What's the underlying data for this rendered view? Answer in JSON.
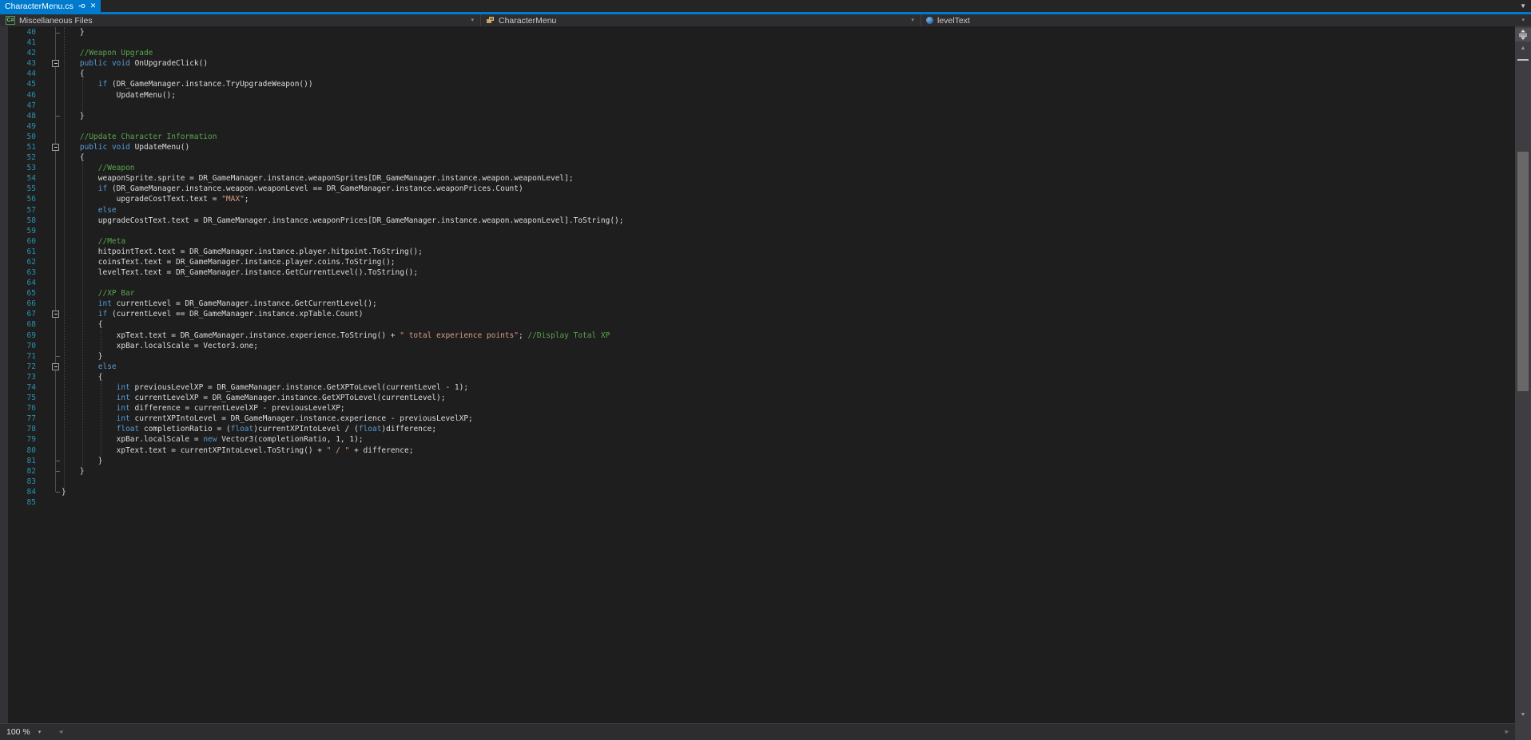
{
  "colors": {
    "accent_blue": "#007ACC",
    "editor_bg": "#1E1E1E",
    "shell_bg": "#2D2D30",
    "line_number": "#2B91AF",
    "keyword": "#569CD6",
    "comment": "#57A64A",
    "string": "#D69D85",
    "plain_text": "#DCDCDC",
    "scrollbar_track": "#3E3E42",
    "scrollbar_thumb": "#686868"
  },
  "icons": {
    "dropdown": "▾",
    "doc_dropdown": "▼",
    "close": "✕",
    "scroll_up": "▲",
    "scroll_down": "▼",
    "scroll_left": "◄",
    "scroll_right": "►",
    "csharp_badge_text": "C#"
  },
  "tab_bar": {
    "active_tab": "CharacterMenu.cs"
  },
  "nav_bar": {
    "project": "Miscellaneous Files",
    "type": "CharacterMenu",
    "member": "levelText"
  },
  "status_bar": {
    "zoom_level": "100 %"
  },
  "editor": {
    "first_line": 40,
    "fold_boxes": [
      43,
      51,
      67,
      72
    ],
    "fold_ticks": [
      40,
      48,
      71,
      81,
      82,
      84
    ],
    "indent_guides": [
      [
        0,
        40,
        83
      ],
      [
        1,
        45,
        47
      ],
      [
        1,
        53,
        81
      ],
      [
        2,
        69,
        70
      ],
      [
        2,
        74,
        80
      ]
    ],
    "lines": [
      {
        "n": 40,
        "t": [
          [
            "p",
            "    }"
          ]
        ]
      },
      {
        "n": 41,
        "t": []
      },
      {
        "n": 42,
        "t": [
          [
            "c",
            "    //Weapon Upgrade"
          ]
        ]
      },
      {
        "n": 43,
        "t": [
          [
            "p",
            "    "
          ],
          [
            "k",
            "public"
          ],
          [
            "p",
            " "
          ],
          [
            "k",
            "void"
          ],
          [
            "p",
            " OnUpgradeClick()"
          ]
        ]
      },
      {
        "n": 44,
        "t": [
          [
            "p",
            "    {"
          ]
        ]
      },
      {
        "n": 45,
        "t": [
          [
            "p",
            "        "
          ],
          [
            "k",
            "if"
          ],
          [
            "p",
            " (DR_GameManager.instance.TryUpgradeWeapon())"
          ]
        ]
      },
      {
        "n": 46,
        "t": [
          [
            "p",
            "            UpdateMenu();"
          ]
        ]
      },
      {
        "n": 47,
        "t": []
      },
      {
        "n": 48,
        "t": [
          [
            "p",
            "    }"
          ]
        ]
      },
      {
        "n": 49,
        "t": []
      },
      {
        "n": 50,
        "t": [
          [
            "c",
            "    //Update Character Information"
          ]
        ]
      },
      {
        "n": 51,
        "t": [
          [
            "p",
            "    "
          ],
          [
            "k",
            "public"
          ],
          [
            "p",
            " "
          ],
          [
            "k",
            "void"
          ],
          [
            "p",
            " UpdateMenu()"
          ]
        ]
      },
      {
        "n": 52,
        "t": [
          [
            "p",
            "    {"
          ]
        ]
      },
      {
        "n": 53,
        "t": [
          [
            "c",
            "        //Weapon"
          ]
        ]
      },
      {
        "n": 54,
        "t": [
          [
            "p",
            "        weaponSprite.sprite = DR_GameManager.instance.weaponSprites[DR_GameManager.instance.weapon.weaponLevel];"
          ]
        ]
      },
      {
        "n": 55,
        "t": [
          [
            "p",
            "        "
          ],
          [
            "k",
            "if"
          ],
          [
            "p",
            " (DR_GameManager.instance.weapon.weaponLevel == DR_GameManager.instance.weaponPrices.Count)"
          ]
        ]
      },
      {
        "n": 56,
        "t": [
          [
            "p",
            "            upgradeCostText.text = "
          ],
          [
            "s",
            "\"MAX\""
          ],
          [
            "p",
            ";"
          ]
        ]
      },
      {
        "n": 57,
        "t": [
          [
            "p",
            "        "
          ],
          [
            "k",
            "else"
          ]
        ]
      },
      {
        "n": 58,
        "t": [
          [
            "p",
            "        upgradeCostText.text = DR_GameManager.instance.weaponPrices[DR_GameManager.instance.weapon.weaponLevel].ToString();"
          ]
        ]
      },
      {
        "n": 59,
        "t": []
      },
      {
        "n": 60,
        "t": [
          [
            "c",
            "        //Meta"
          ]
        ]
      },
      {
        "n": 61,
        "t": [
          [
            "p",
            "        hitpointText.text = DR_GameManager.instance.player.hitpoint.ToString();"
          ]
        ]
      },
      {
        "n": 62,
        "t": [
          [
            "p",
            "        coinsText.text = DR_GameManager.instance.player.coins.ToString();"
          ]
        ]
      },
      {
        "n": 63,
        "t": [
          [
            "p",
            "        levelText.text = DR_GameManager.instance.GetCurrentLevel().ToString();"
          ]
        ]
      },
      {
        "n": 64,
        "t": []
      },
      {
        "n": 65,
        "t": [
          [
            "c",
            "        //XP Bar"
          ]
        ]
      },
      {
        "n": 66,
        "t": [
          [
            "p",
            "        "
          ],
          [
            "k",
            "int"
          ],
          [
            "p",
            " currentLevel = DR_GameManager.instance.GetCurrentLevel();"
          ]
        ]
      },
      {
        "n": 67,
        "t": [
          [
            "p",
            "        "
          ],
          [
            "k",
            "if"
          ],
          [
            "p",
            " (currentLevel == DR_GameManager.instance.xpTable.Count)"
          ]
        ]
      },
      {
        "n": 68,
        "t": [
          [
            "p",
            "        {"
          ]
        ]
      },
      {
        "n": 69,
        "t": [
          [
            "p",
            "            xpText.text = DR_GameManager.instance.experience.ToString() + "
          ],
          [
            "s",
            "\" total experience points\""
          ],
          [
            "p",
            "; "
          ],
          [
            "c",
            "//Display Total XP"
          ]
        ]
      },
      {
        "n": 70,
        "t": [
          [
            "p",
            "            xpBar.localScale = Vector3.one;"
          ]
        ]
      },
      {
        "n": 71,
        "t": [
          [
            "p",
            "        }"
          ]
        ]
      },
      {
        "n": 72,
        "t": [
          [
            "p",
            "        "
          ],
          [
            "k",
            "else"
          ]
        ]
      },
      {
        "n": 73,
        "t": [
          [
            "p",
            "        {"
          ]
        ]
      },
      {
        "n": 74,
        "t": [
          [
            "p",
            "            "
          ],
          [
            "k",
            "int"
          ],
          [
            "p",
            " previousLevelXP = DR_GameManager.instance.GetXPToLevel(currentLevel - 1);"
          ]
        ]
      },
      {
        "n": 75,
        "t": [
          [
            "p",
            "            "
          ],
          [
            "k",
            "int"
          ],
          [
            "p",
            " currentLevelXP = DR_GameManager.instance.GetXPToLevel(currentLevel);"
          ]
        ]
      },
      {
        "n": 76,
        "t": [
          [
            "p",
            "            "
          ],
          [
            "k",
            "int"
          ],
          [
            "p",
            " difference = currentLevelXP - previousLevelXP;"
          ]
        ]
      },
      {
        "n": 77,
        "t": [
          [
            "p",
            "            "
          ],
          [
            "k",
            "int"
          ],
          [
            "p",
            " currentXPIntoLevel = DR_GameManager.instance.experience - previousLevelXP;"
          ]
        ]
      },
      {
        "n": 78,
        "t": [
          [
            "p",
            "            "
          ],
          [
            "k",
            "float"
          ],
          [
            "p",
            " completionRatio = ("
          ],
          [
            "k",
            "float"
          ],
          [
            "p",
            ")currentXPIntoLevel / ("
          ],
          [
            "k",
            "float"
          ],
          [
            "p",
            ")difference;"
          ]
        ]
      },
      {
        "n": 79,
        "t": [
          [
            "p",
            "            xpBar.localScale = "
          ],
          [
            "k",
            "new"
          ],
          [
            "p",
            " Vector3(completionRatio, 1, 1);"
          ]
        ]
      },
      {
        "n": 80,
        "t": [
          [
            "p",
            "            xpText.text = currentXPIntoLevel.ToString() + "
          ],
          [
            "s",
            "\" / \""
          ],
          [
            "p",
            " + difference;"
          ]
        ]
      },
      {
        "n": 81,
        "t": [
          [
            "p",
            "        }"
          ]
        ]
      },
      {
        "n": 82,
        "t": [
          [
            "p",
            "    }"
          ]
        ]
      },
      {
        "n": 83,
        "t": []
      },
      {
        "n": 84,
        "t": [
          [
            "p",
            "}"
          ]
        ]
      },
      {
        "n": 85,
        "t": []
      }
    ]
  }
}
